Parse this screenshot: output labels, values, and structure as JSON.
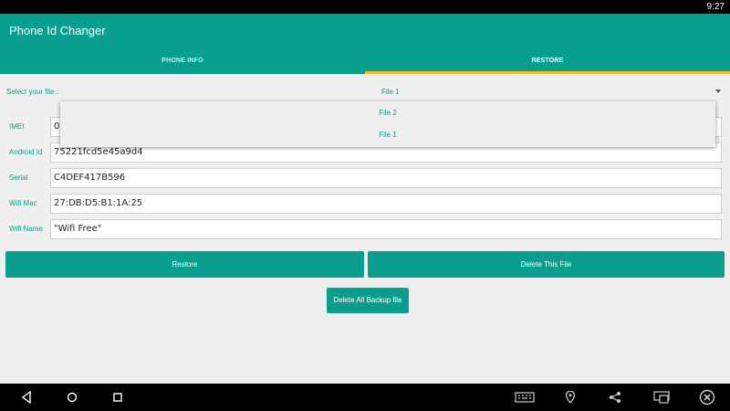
{
  "status_bar": {
    "time": "9:27"
  },
  "app": {
    "title": "Phone Id Changer"
  },
  "tabs": [
    {
      "label": "PHONE INFO",
      "selected": false
    },
    {
      "label": "RESTORE",
      "selected": true
    }
  ],
  "colors": {
    "accent": "#0a9e8e",
    "tab_indicator": "#f2c020"
  },
  "file_select": {
    "label": "Select your file :",
    "value": "File 1",
    "options": [
      "File 2",
      "File 1"
    ]
  },
  "fields": [
    {
      "label": "IMEI",
      "value": "0"
    },
    {
      "label": "Android Id",
      "value": "75221fcd5e45a9d4"
    },
    {
      "label": "Serial",
      "value": "C4DEF417B596"
    },
    {
      "label": "Wifi Mac",
      "value": "27:DB:D5:B1:1A:25"
    },
    {
      "label": "Wifi Name",
      "value": "\"Wifi Free\""
    }
  ],
  "buttons": {
    "restore": "Restore",
    "delete_file": "Delete This File",
    "delete_all": "Delete All Backup file"
  },
  "nav_bar": {
    "icons": [
      "back-icon",
      "home-icon",
      "recents-icon",
      "keyboard-icon",
      "location-icon",
      "share-icon",
      "cast-icon",
      "close-icon"
    ]
  }
}
